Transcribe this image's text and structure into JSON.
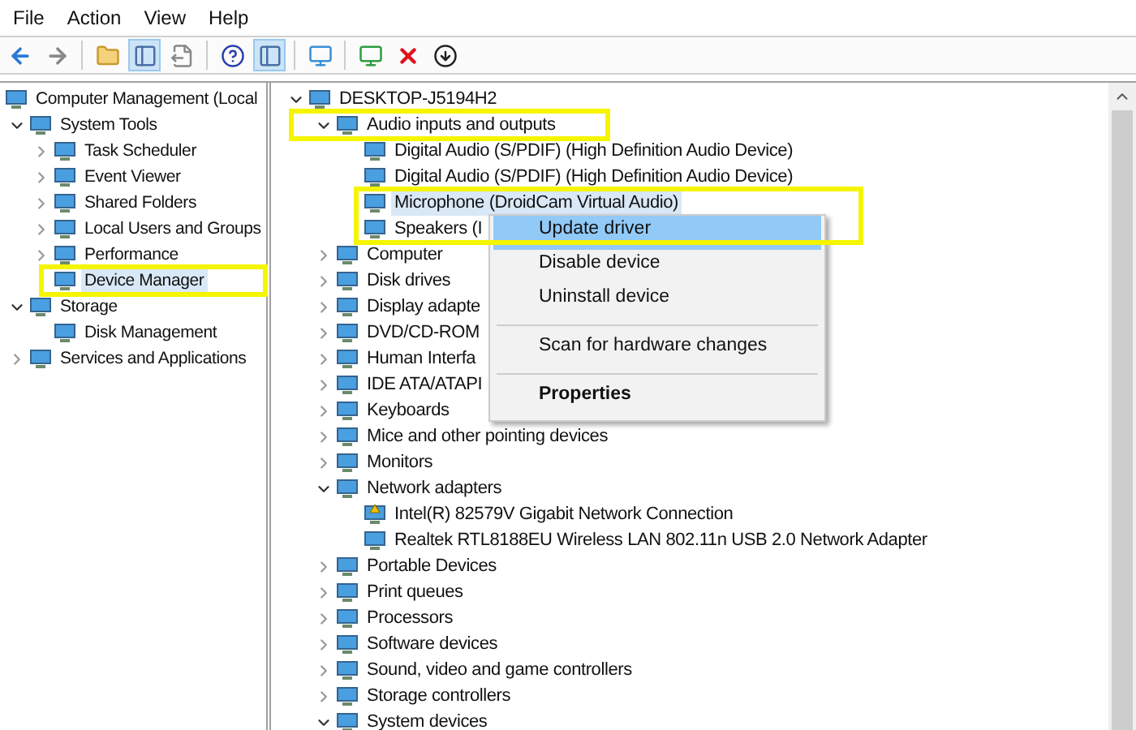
{
  "menu_bar": [
    "File",
    "Action",
    "View",
    "Help"
  ],
  "toolbar": [
    {
      "kind": "back",
      "pressed": false
    },
    {
      "kind": "forward",
      "pressed": false
    },
    {
      "kind": "sep"
    },
    {
      "kind": "up",
      "pressed": false
    },
    {
      "kind": "pane",
      "pressed": true
    },
    {
      "kind": "export",
      "pressed": false
    },
    {
      "kind": "sep"
    },
    {
      "kind": "help",
      "pressed": false
    },
    {
      "kind": "pane",
      "pressed": true
    },
    {
      "kind": "sep"
    },
    {
      "kind": "monitor",
      "pressed": false
    },
    {
      "kind": "sep"
    },
    {
      "kind": "enable",
      "pressed": false
    },
    {
      "kind": "remove",
      "pressed": false
    },
    {
      "kind": "update",
      "pressed": false
    }
  ],
  "console_tree": [
    {
      "label": "Computer Management (Local",
      "selected": false,
      "children": [
        {
          "label": "System Tools",
          "expanded": true,
          "selected": false,
          "children": [
            {
              "label": "Task Scheduler",
              "expanded": false,
              "selected": false
            },
            {
              "label": "Event Viewer",
              "expanded": false,
              "selected": false
            },
            {
              "label": "Shared Folders",
              "expanded": false,
              "selected": false
            },
            {
              "label": "Local Users and Groups",
              "expanded": false,
              "selected": false
            },
            {
              "label": "Performance",
              "expanded": false,
              "selected": false
            },
            {
              "label": "Device Manager",
              "selected": true
            }
          ]
        },
        {
          "label": "Storage",
          "expanded": true,
          "selected": false,
          "children": [
            {
              "label": "Disk Management",
              "selected": false
            }
          ]
        },
        {
          "label": "Services and Applications",
          "expanded": false,
          "selected": false
        }
      ]
    }
  ],
  "device_tree": [
    {
      "label": "DESKTOP-J5194H2",
      "expanded": true,
      "selected": false,
      "children": [
        {
          "label": "Audio inputs and outputs",
          "expanded": true,
          "selected": false,
          "children": [
            {
              "label": "Digital Audio (S/PDIF) (High Definition Audio Device)",
              "selected": false
            },
            {
              "label": "Digital Audio (S/PDIF) (High Definition Audio Device)",
              "selected": false
            },
            {
              "label": "Microphone (DroidCam Virtual Audio)",
              "selected": true
            },
            {
              "label": "Speakers (I",
              "selected": false
            }
          ]
        },
        {
          "label": "Computer",
          "expanded": false,
          "selected": false
        },
        {
          "label": "Disk drives",
          "expanded": false,
          "selected": false
        },
        {
          "label": "Display adapte",
          "expanded": false,
          "selected": false
        },
        {
          "label": "DVD/CD-ROM",
          "expanded": false,
          "selected": false
        },
        {
          "label": "Human Interfa",
          "expanded": false,
          "selected": false
        },
        {
          "label": "IDE ATA/ATAPI",
          "expanded": false,
          "selected": false
        },
        {
          "label": "Keyboards",
          "expanded": false,
          "selected": false
        },
        {
          "label": "Mice and other pointing devices",
          "expanded": false,
          "selected": false
        },
        {
          "label": "Monitors",
          "expanded": false,
          "selected": false
        },
        {
          "label": "Network adapters",
          "expanded": true,
          "selected": false,
          "children": [
            {
              "label": "Intel(R) 82579V Gigabit Network Connection",
              "selected": false,
              "warning": true
            },
            {
              "label": "Realtek RTL8188EU Wireless LAN 802.11n USB 2.0 Network Adapter",
              "selected": false,
              "warning": false
            }
          ]
        },
        {
          "label": "Portable Devices",
          "expanded": false,
          "selected": false
        },
        {
          "label": "Print queues",
          "expanded": false,
          "selected": false
        },
        {
          "label": "Processors",
          "expanded": false,
          "selected": false
        },
        {
          "label": "Software devices",
          "expanded": false,
          "selected": false
        },
        {
          "label": "Sound, video and game controllers",
          "expanded": false,
          "selected": false
        },
        {
          "label": "Storage controllers",
          "expanded": false,
          "selected": false
        },
        {
          "label": "System devices",
          "expanded": true,
          "selected": false
        }
      ]
    }
  ],
  "context_menu": [
    {
      "kind": "item",
      "label": "Update driver",
      "selected": true,
      "default": false
    },
    {
      "kind": "item",
      "label": "Disable device",
      "selected": false,
      "default": false
    },
    {
      "kind": "item",
      "label": "Uninstall device",
      "selected": false,
      "default": false
    },
    {
      "kind": "separator"
    },
    {
      "kind": "item",
      "label": "Scan for hardware changes",
      "selected": false,
      "default": false
    },
    {
      "kind": "separator"
    },
    {
      "kind": "item",
      "label": "Properties",
      "selected": false,
      "default": true
    }
  ]
}
